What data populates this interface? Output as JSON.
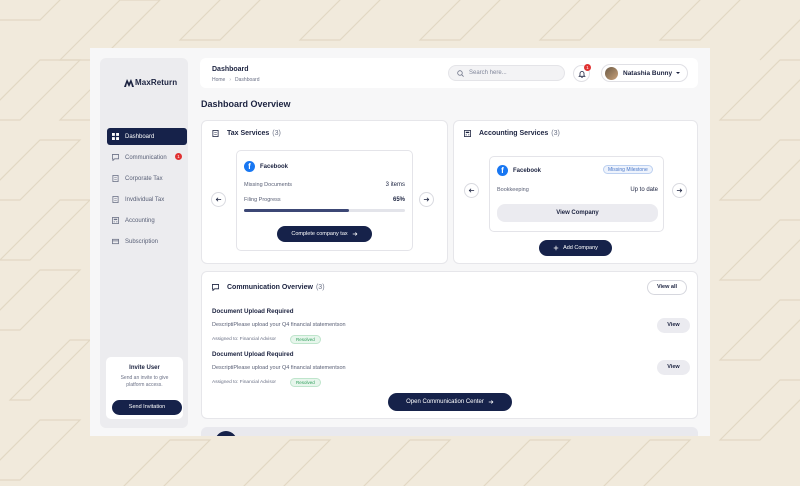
{
  "app": {
    "brand": "MaxReturn"
  },
  "sidebar": {
    "items": [
      {
        "label": "Dashboard",
        "icon": "grid-icon",
        "active": true
      },
      {
        "label": "Communication",
        "icon": "chat-icon",
        "badge": "1"
      },
      {
        "label": "Corporate Tax",
        "icon": "document-icon"
      },
      {
        "label": "Invdividual Tax",
        "icon": "document-icon"
      },
      {
        "label": "Accounting",
        "icon": "calculator-icon"
      },
      {
        "label": "Subscription",
        "icon": "card-icon"
      }
    ],
    "invite": {
      "title": "Invite User",
      "description": "Send an invite to give platform access.",
      "button": "Send Invitation"
    }
  },
  "header": {
    "title": "Dashboard",
    "breadcrumb": [
      "Home",
      "Dashboard"
    ],
    "search_placeholder": "Search here...",
    "notifications": "1",
    "user_name": "Natashia Bunny"
  },
  "page": {
    "title": "Dashboard Overview"
  },
  "tax_services": {
    "title": "Tax Services",
    "count": "(3)",
    "company": "Facebook",
    "missing_label": "Missing Documents",
    "missing_value": "3 items",
    "progress_label": "Filing Progress",
    "progress_value": "65%",
    "progress_fraction": 0.65,
    "button": "Complete company tax"
  },
  "accounting_services": {
    "title": "Accounting Services",
    "count": "(3)",
    "company": "Facebook",
    "status": "Missing Milestone",
    "row_label": "Bookkeeping",
    "row_value": "Up to date",
    "view_button": "View Company",
    "add_button": "Add Company"
  },
  "communication": {
    "title": "Communication Overview",
    "count": "(3)",
    "view_all": "View all",
    "items": [
      {
        "title": "Document Upload Required",
        "description": "DescriptiPlease upload your Q4 financial statementson",
        "assigned": "Assigned to: Financial Advisor",
        "status": "Resolved",
        "action": "View"
      },
      {
        "title": "Document Upload Required",
        "description": "DescriptiPlease upload your Q4 financial statementson",
        "assigned": "Assigned to: Financial Advisor",
        "status": "Resolved",
        "action": "View"
      }
    ],
    "button": "Open Communication Center"
  },
  "colors": {
    "primary": "#16224a",
    "background": "#f1eadc",
    "badge": "#e03131",
    "success": "#2e9d5a",
    "facebook": "#1877f2"
  }
}
